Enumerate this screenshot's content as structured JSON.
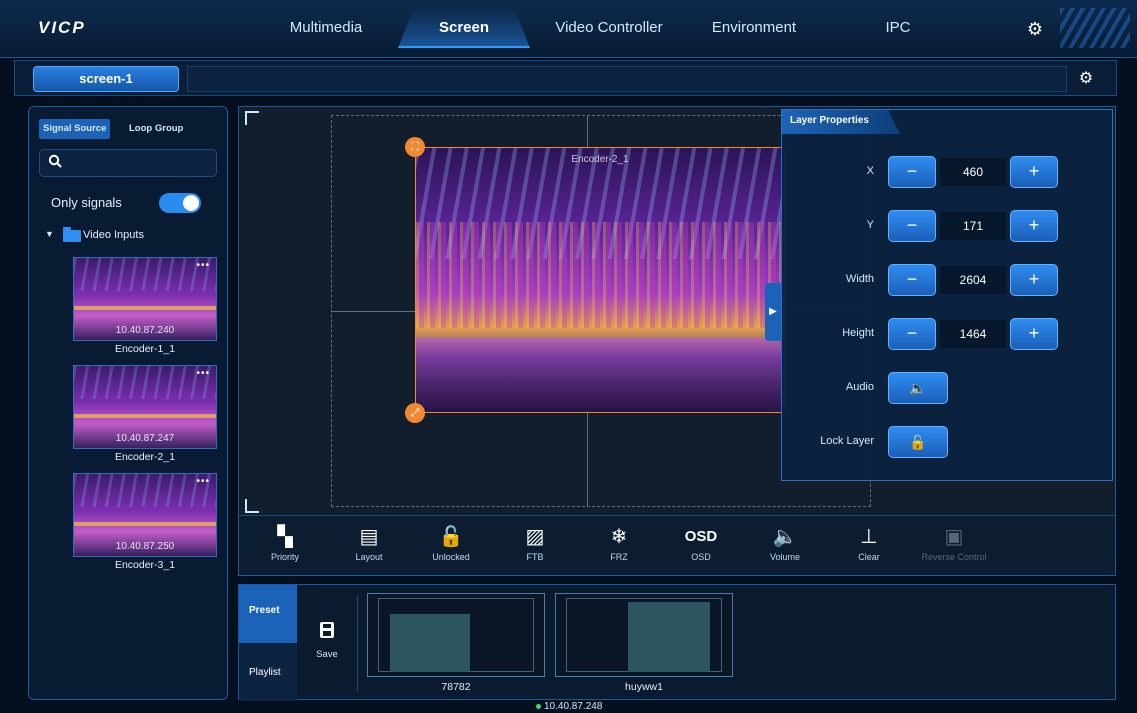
{
  "app": {
    "logo": "VICP"
  },
  "nav": {
    "tabs": [
      {
        "label": "Multimedia"
      },
      {
        "label": "Screen",
        "active": true
      },
      {
        "label": "Video Controller"
      },
      {
        "label": "Environment"
      },
      {
        "label": "IPC"
      }
    ],
    "settings_icon": "gear-icon"
  },
  "screenbar": {
    "tab_label": "screen-1",
    "settings_icon": "gear-icon"
  },
  "sources": {
    "tabs": [
      {
        "label": "Signal Source",
        "active": true
      },
      {
        "label": "Loop Group"
      }
    ],
    "search_placeholder": "",
    "search_value": "",
    "only_signals_label": "Only signals",
    "only_signals_on": true,
    "folder_label": "Video Inputs",
    "encoders": [
      {
        "name": "Encoder-1_1",
        "ip": "10.40.87.240"
      },
      {
        "name": "Encoder-2_1",
        "ip": "10.40.87.247"
      },
      {
        "name": "Encoder-3_1",
        "ip": "10.40.87.250"
      }
    ],
    "thumb_menu": "•••"
  },
  "canvas": {
    "layer_label": "Encoder-2_1"
  },
  "layer_properties": {
    "title": "Layer Properties",
    "x_label": "X",
    "x_value": "460",
    "y_label": "Y",
    "y_value": "171",
    "width_label": "Width",
    "width_value": "2604",
    "height_label": "Height",
    "height_value": "1464",
    "audio_label": "Audio",
    "lock_label": "Lock Layer",
    "minus": "−",
    "plus": "+"
  },
  "toolbar": {
    "items": [
      {
        "label": "Priority",
        "icon": "priority-icon",
        "glyph": "▚"
      },
      {
        "label": "Layout",
        "icon": "layout-icon",
        "glyph": "▤"
      },
      {
        "label": "Unlocked",
        "icon": "unlock-icon",
        "glyph": "🔓"
      },
      {
        "label": "FTB",
        "icon": "ftb-icon",
        "glyph": "▨"
      },
      {
        "label": "FRZ",
        "icon": "snowflake-icon",
        "glyph": "❄"
      },
      {
        "label": "OSD",
        "icon": "osd-icon",
        "glyph": "OSD"
      },
      {
        "label": "Volume",
        "icon": "volume-icon",
        "glyph": "🔈"
      },
      {
        "label": "Clear",
        "icon": "clear-icon",
        "glyph": "⊥"
      },
      {
        "label": "Reverse Control",
        "icon": "reverse-control-icon",
        "glyph": "▣",
        "disabled": true
      }
    ]
  },
  "presets": {
    "tabs": [
      {
        "label": "Preset",
        "active": true
      },
      {
        "label": "Playlist"
      }
    ],
    "save_label": "Save",
    "items": [
      {
        "name": "78782"
      },
      {
        "name": "huyww1"
      }
    ]
  },
  "status": {
    "ip": "10.40.87.248"
  },
  "colors": {
    "accent": "#2f8cf0",
    "handle": "#f08a32",
    "background": "#04101f"
  }
}
